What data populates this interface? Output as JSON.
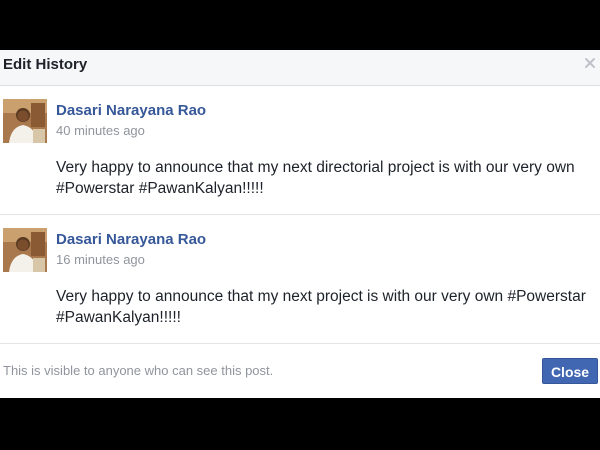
{
  "dialog": {
    "title": "Edit History",
    "close_icon": "close-x-icon"
  },
  "entries": [
    {
      "author": "Dasari Narayana Rao",
      "time": "40 minutes ago",
      "text": "Very happy to announce that my next directorial project is with our very own #Powerstar #PawanKalyan!!!!!",
      "avatar_icon": "profile-photo"
    },
    {
      "author": "Dasari Narayana Rao",
      "time": "16 minutes ago",
      "text": "Very happy to announce that my next project is with our very own #Powerstar #PawanKalyan!!!!!",
      "avatar_icon": "profile-photo"
    }
  ],
  "footer": {
    "note": "This is visible to anyone who can see this post.",
    "close_label": "Close"
  },
  "colors": {
    "accent": "#4267b2",
    "link": "#365899",
    "muted": "#90949c",
    "header_bg": "#f6f7f9"
  }
}
